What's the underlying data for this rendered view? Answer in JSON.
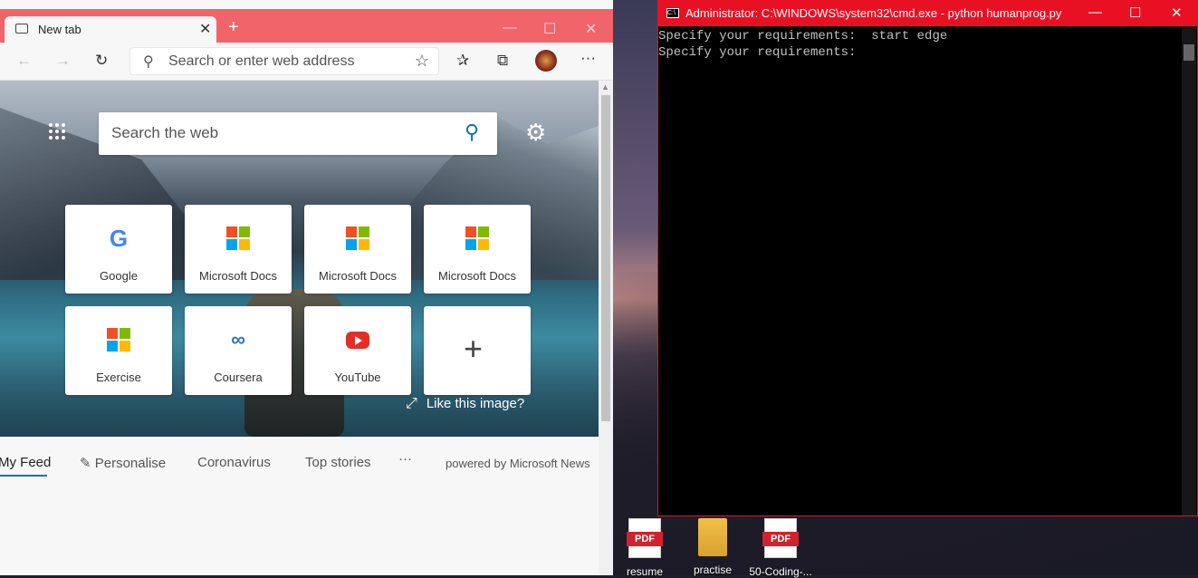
{
  "edge": {
    "tab_title": "New tab",
    "tab_close": "✕",
    "new_tab": "+",
    "address_placeholder": "Search or enter web address",
    "web_search_placeholder": "Search the web",
    "tiles": [
      {
        "label": "Google",
        "icon": "google-icon"
      },
      {
        "label": "Microsoft Docs",
        "icon": "microsoft-icon"
      },
      {
        "label": "Microsoft Docs",
        "icon": "microsoft-icon"
      },
      {
        "label": "Microsoft Docs",
        "icon": "microsoft-icon"
      },
      {
        "label": "Exercise",
        "icon": "microsoft-icon"
      },
      {
        "label": "Coursera",
        "icon": "coursera-icon"
      },
      {
        "label": "YouTube",
        "icon": "youtube-icon"
      },
      {
        "label": "",
        "icon": "plus-icon"
      }
    ],
    "like_image": "Like this image?",
    "feed": {
      "my_feed": "My Feed",
      "personalise": "Personalise",
      "coronavirus": "Coronavirus",
      "top_stories": "Top stories",
      "more": "···",
      "powered_by": "powered by Microsoft News"
    },
    "accent_color": "#0a6fbf",
    "titlebar_color": "#f0646a"
  },
  "cmd": {
    "title": "Administrator: C:\\WINDOWS\\system32\\cmd.exe - python  humanprog.py",
    "lines": [
      "Specify your requirements:  start edge",
      "Specify your requirements: "
    ],
    "border_color": "#e81123"
  },
  "desktop": {
    "icons": [
      {
        "label": "resume",
        "type": "pdf"
      },
      {
        "label": "practise",
        "type": "folder"
      },
      {
        "label": "50-Coding-...",
        "type": "pdf"
      }
    ],
    "pdf_badge": "PDF"
  }
}
